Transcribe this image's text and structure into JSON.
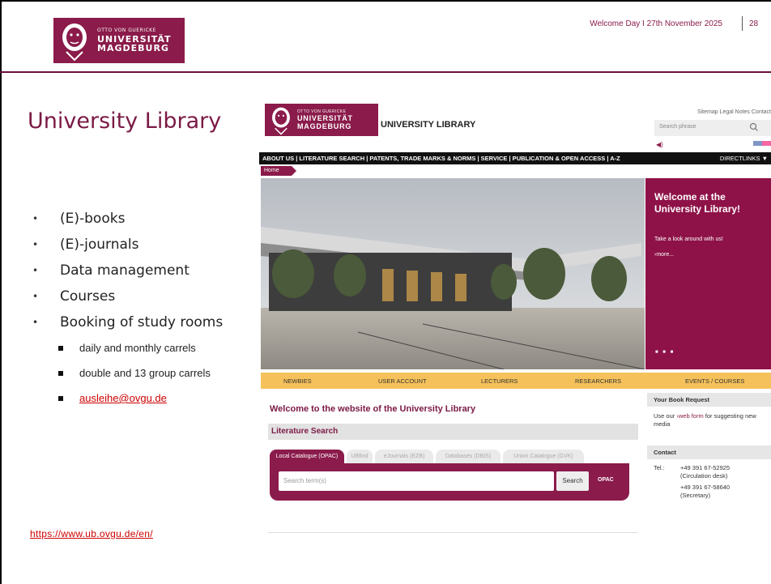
{
  "header": {
    "logo": {
      "line1": "OTTO VON GUERICKE",
      "line2": "UNIVERSITÄT",
      "line3": "MAGDEBURG"
    },
    "headline": "Welcome Day I 27th November 2025",
    "page_number": "28"
  },
  "slide": {
    "title": "University Library",
    "bullets": [
      "(E)-books",
      "(E)-journals",
      "Data management",
      "Courses",
      "Booking of study rooms"
    ],
    "sub_bullets": [
      "daily and monthly carrels",
      "double and 13 group carrels"
    ],
    "email": "ausleihe@ovgu.de",
    "url": "https://www.ub.ovgu.de/en/"
  },
  "website": {
    "logo": {
      "line1": "OTTO VON GUERICKE",
      "line2": "UNIVERSITÄT",
      "line3": "MAGDEBURG"
    },
    "site_name": "UNIVERSITY LIBRARY",
    "top_links": "Sitemap  Legal Notes  Contact",
    "search_placeholder": "Search phrase",
    "nav": "ABOUT US | LITERATURE SEARCH | PATENTS, TRADE MARKS & NORMS | SERVICE | PUBLICATION & OPEN ACCESS | A-Z",
    "directlinks": "DIRECTLINKS ▼",
    "breadcrumb": "Home",
    "promo": {
      "heading": "Welcome at the University Library!",
      "text": "Take a look around with us!",
      "more": "›more..."
    },
    "yellow_nav": [
      "NEWBIES",
      "USER ACCOUNT",
      "LECTURERS",
      "RESEARCHERS",
      "EVENTS / COURSES"
    ],
    "welcome": "Welcome to the website of the University Library",
    "lit_search": "Literature Search",
    "tabs": [
      "Local Catalogue (OPAC)",
      "UBfind",
      "eJournals (EZB)",
      "Databases (DBIS)",
      "Union Catalogue (GVK)"
    ],
    "search_term_placeholder": "Search term(s)",
    "search_button": "Search",
    "opac_label": "OPAC",
    "book_request": {
      "title": "Your Book Request",
      "text_pre": "Use our ",
      "link": "›web form",
      "text_post": " for suggesting new media"
    },
    "contact": {
      "title": "Contact",
      "tel_label": "Tel.:",
      "phone1": "+49 391 67-52925",
      "phone1_note": "(Circulation desk)",
      "phone2": "+49 391 67-58640",
      "phone2_note": "(Secretary)"
    }
  }
}
